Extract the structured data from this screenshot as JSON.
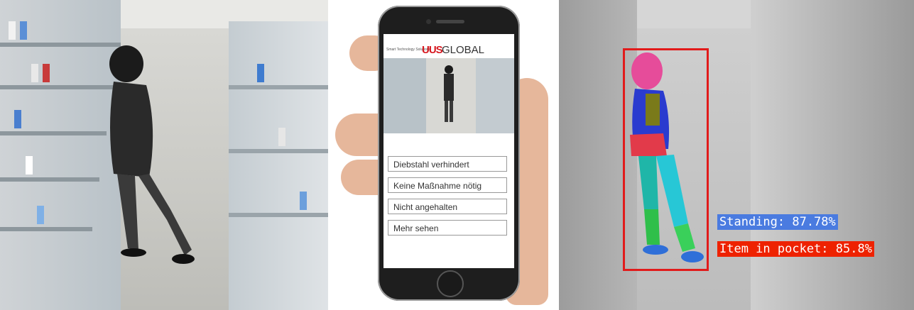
{
  "left_panel": {
    "description_icon": "cctv-frame"
  },
  "phone": {
    "brand_tagline": "Smart Technology Solutions",
    "brand_logo_mark": "UUS",
    "brand_logo_text": "GLOBAL",
    "menu_items": [
      {
        "label": "Diebstahl verhindert"
      },
      {
        "label": "Keine Maßnahme nötig"
      },
      {
        "label": "Nicht angehalten"
      },
      {
        "label": "Mehr sehen"
      }
    ]
  },
  "detection": {
    "labels": [
      {
        "text": "Standing: 87.78%",
        "color": "#4a7be0"
      },
      {
        "text": "Item in pocket: 85.8%",
        "color": "#ee2200"
      }
    ],
    "box_color": "#e11b1b"
  }
}
